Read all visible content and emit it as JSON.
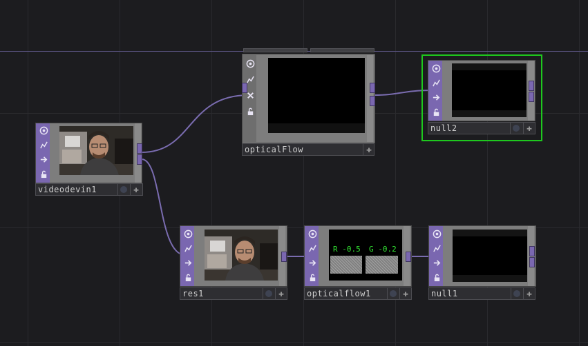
{
  "canvas": {
    "background": "#1c1c1f",
    "grid_line": "#2a2a2e",
    "horizontal_line": "#5a5380"
  },
  "colors": {
    "op_strip": "#7a67b0",
    "wire": "#7a6cb0",
    "selection": "#1ec81e",
    "channel_text": "#32e632"
  },
  "nodes": {
    "videodevin1": {
      "name": "videodevin1",
      "icons": [
        "viewer-icon",
        "cook-icon",
        "export-icon",
        "lock-icon"
      ]
    },
    "opticalFlow": {
      "name": "opticalFlow",
      "icons": [
        "viewer-icon",
        "cook-icon",
        "close-icon",
        "lock-icon"
      ]
    },
    "null2": {
      "name": "null2",
      "selected": true,
      "icons": [
        "viewer-icon",
        "cook-icon",
        "export-icon",
        "lock-icon"
      ]
    },
    "res1": {
      "name": "res1",
      "icons": [
        "viewer-icon",
        "cook-icon",
        "export-icon",
        "lock-icon"
      ]
    },
    "opticalflow1": {
      "name": "opticalflow1",
      "icons": [
        "viewer-icon",
        "cook-icon",
        "export-icon",
        "lock-icon"
      ],
      "channels": {
        "r": "R -0.5",
        "g": "G -0.2"
      }
    },
    "null1": {
      "name": "null1",
      "icons": [
        "viewer-icon",
        "cook-icon",
        "export-icon",
        "lock-icon"
      ]
    }
  }
}
